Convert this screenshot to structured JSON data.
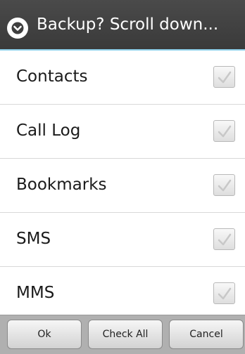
{
  "dialog": {
    "title": "Backup? Scroll down...",
    "title_icon": "chevron-down-circle-icon"
  },
  "items": [
    {
      "label": "Contacts",
      "checked": true
    },
    {
      "label": "Call Log",
      "checked": true
    },
    {
      "label": "Bookmarks",
      "checked": true
    },
    {
      "label": "SMS",
      "checked": true
    },
    {
      "label": "MMS",
      "checked": true
    }
  ],
  "buttons": {
    "ok": "Ok",
    "check_all": "Check All",
    "cancel": "Cancel"
  },
  "colors": {
    "title_bg": "#3f3f3f",
    "title_accent": "#8fd0ea",
    "check_mark": "#c8c8c8"
  }
}
